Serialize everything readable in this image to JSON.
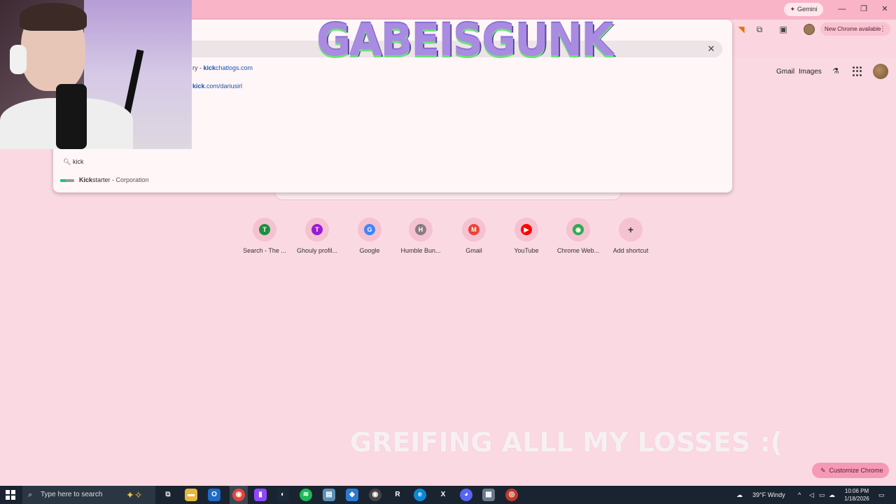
{
  "browser": {
    "gemini_label": "Gemini",
    "update_label": "New Chrome available",
    "window_controls": [
      "minimize-icon",
      "restore-icon",
      "close-icon"
    ]
  },
  "google_header": {
    "gmail": "Gmail",
    "images": "Images"
  },
  "omnibox": {
    "suggestions": [
      {
        "prefix": "ry - ",
        "bold": "kick",
        "rest": "chatlogs.com"
      },
      {
        "prefix": "",
        "bold": "kick",
        "rest": ".com/dariusirl"
      }
    ],
    "search_text": "kick",
    "entity": {
      "bold": "Kick",
      "rest": "starter",
      "desc": " - Corporation"
    }
  },
  "shortcuts": [
    {
      "label": "Search - The ...",
      "letter": "T",
      "color": "#1e8e3e"
    },
    {
      "label": "Ghouly profil...",
      "letter": "T",
      "color": "#9b1bd6"
    },
    {
      "label": "Google",
      "letter": "G",
      "color": "#4285f4"
    },
    {
      "label": "Humble Bun...",
      "letter": "H",
      "color": "#8a7a82"
    },
    {
      "label": "Gmail",
      "letter": "M",
      "color": "#ea4335"
    },
    {
      "label": "YouTube",
      "letter": "▶",
      "color": "#ff0000"
    },
    {
      "label": "Chrome Web...",
      "letter": "◉",
      "color": "#34a853"
    },
    {
      "label": "Add shortcut",
      "letter": "+",
      "color": "#f4c2d0"
    }
  ],
  "overlay": {
    "banner": "GABEISGUNK",
    "subtitle": "GREIFING ALLL MY LOSSES :("
  },
  "customize_label": "Customize Chrome",
  "taskbar": {
    "search_placeholder": "Type here to search",
    "weather": "39°F  Windy",
    "time": "10:06 PM",
    "date": "1/18/2026"
  }
}
